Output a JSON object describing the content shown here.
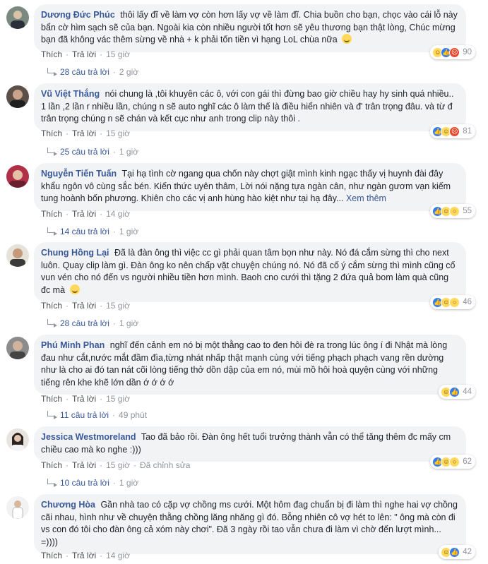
{
  "labels": {
    "like": "Thích",
    "reply": "Trả lời",
    "sep": "·"
  },
  "comments": [
    {
      "author": "Dương Đức Phúc",
      "text": "thôi lấy đĩ về làm vợ còn hơn lấy vợ về làm đĩ. Chia buồn cho bạn, chọc vào cái lỗ này bẩn cờ hìm sạch sẽ của bạn. Ngoài kia còn nhiều người tốt hơn sẽ yêu thương bạn thật lòng, Chúc mừng bạn đã không vác thêm sừng về nhà + k phải tốn tiền vì hạng LoL chùa nữa",
      "has_emoji": true,
      "reaction_count": "90",
      "reactions": [
        "haha",
        "like",
        "angry"
      ],
      "time": "15 giờ",
      "edited": "",
      "replies": "28 câu trả lời",
      "replies_time": "2 giờ"
    },
    {
      "author": "Vũ Việt Thắng",
      "text": "nói chung là ,tôi khuyên các ô, với con gái thì đừng bao giờ chiều hay hy sinh quá nhiều.. 1 lần ,2 lần r nhiều lần, chúng n sẽ auto nghĩ các ô làm thế là điều hiển nhiên và đ' trân trọng đâu. và từ đ trân trọng chúng n sẽ chán và kết cục như anh trong clip này thôi .",
      "has_emoji": false,
      "reaction_count": "81",
      "reactions": [
        "like",
        "haha",
        "angry"
      ],
      "time": "15 giờ",
      "edited": "",
      "replies": "25 câu trả lời",
      "replies_time": "1 giờ"
    },
    {
      "author": "Nguyễn Tiến Tuấn",
      "text": "Tại hạ tình cờ ngang qua chốn này chợt giật mình kinh ngạc thấy vị huynh đài đây khẩu ngôn vô cùng sắc bén. Kiến thức uyên thâm, Lời nói nặng tựa ngàn cân, như ngàn gươm vạn kiếm tung hoành bốn phương. Khiên cho các vị anh hùng hào kiệt như tại hạ đây...",
      "see_more": "Xem thêm",
      "has_emoji": false,
      "reaction_count": "55",
      "reactions": [
        "like",
        "haha",
        "wow"
      ],
      "time": "14 giờ",
      "edited": "",
      "replies": "14 câu trả lời",
      "replies_time": "1 giờ"
    },
    {
      "author": "Chung Hồng Lại",
      "text": "Đã là đàn ông thì việc cc gì phải quan tâm bọn như này. Nó đá cắm sừng thì cho next luôn. Quay clip làm gì. Đàn ông ko nên chấp vặt chuyện chúng nó. Nó đã cố ý cắm sừng thì mình cũng cố vun vén cho nó đến vs người nhiều tiền hơn mình. Baoh cno cưới thì tặng 2 đứa quả bom làm quà cũng đc mà",
      "has_emoji": true,
      "reaction_count": "46",
      "reactions": [
        "like",
        "haha",
        "wow"
      ],
      "time": "15 giờ",
      "edited": "",
      "replies": "28 câu trả lời",
      "replies_time": "1 giờ"
    },
    {
      "author": "Phú Minh Phan",
      "text": "nghĩ đến cảnh em nó bị một thằng cao to đen hôi đè ra trong lúc ông í đi Nhật mà lòng đau như cắt,nước mắt đầm đìa,từng nhát nhấp thật mạnh cùng với tiếng phạch phạch vang rền dường như là cho ai đó tan nát cõi lòng tiếng thở dồn dập của em nó, mùi mồ hôi hoà quyện cùng với những tiếng rên khe khẽ lớn dần ớ ớ ớ ớ",
      "has_emoji": false,
      "reaction_count": "44",
      "reactions": [
        "haha",
        "like"
      ],
      "time": "15 giờ",
      "edited": "",
      "replies": "11 câu trả lời",
      "replies_time": "49 phút"
    },
    {
      "author": "Jessica Westmoreland",
      "text": "Tao đã bảo rồi. Đàn ông hết tuổi trưởng thành vẫn có thể tăng thêm đc mấy cm chiều cao mà ko nghe :)))",
      "has_emoji": false,
      "reaction_count": "62",
      "reactions": [
        "like",
        "haha",
        "wow"
      ],
      "time": "15 giờ",
      "edited": "Đã chỉnh sửa",
      "replies": "10 câu trả lời",
      "replies_time": "1 giờ"
    },
    {
      "author": "Chương Hòa",
      "text": "Gần nhà tao có cặp vợ chồng ms cưới. Một hôm đag chuẩn bị đi làm thì nghe hai vợ chồng cãi nhau, hình như về chuyện thằng chồng lăng nhăng gì đó. Bỗng nhiên cô vợ hét to lên: \" ông mà còn đi vs con đó tôi cho đàn ông cả xóm này chơi\". Đã 3 ngày rồi tao vẫn chưa đi làm vì chờ đến lượt mình... =))))",
      "has_emoji": false,
      "reaction_count": "42",
      "reactions": [
        "haha",
        "like"
      ],
      "time": "14 giờ",
      "edited": "",
      "replies": "",
      "replies_time": ""
    }
  ]
}
